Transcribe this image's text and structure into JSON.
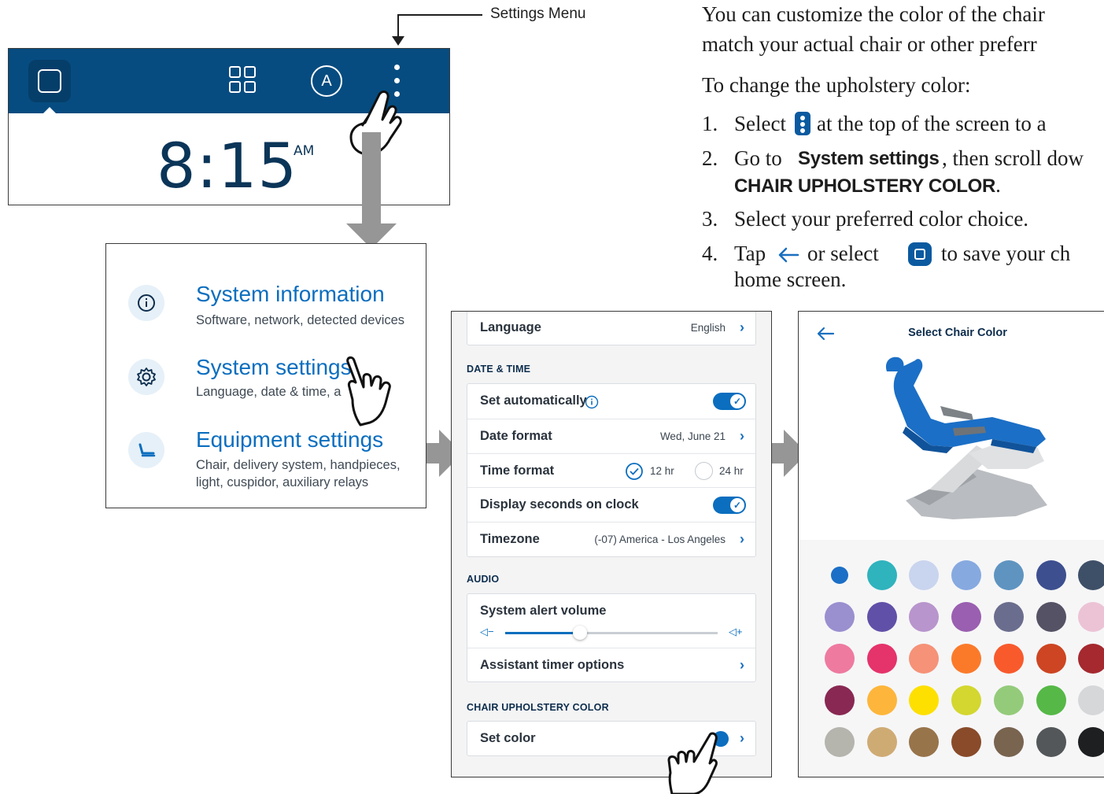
{
  "callout": {
    "settings_menu": "Settings Menu"
  },
  "home_screen": {
    "avatar_letter": "A",
    "time": "8:15",
    "ampm": "AM"
  },
  "settings_menu_list": {
    "items": [
      {
        "title": "System information",
        "subtitle": "Software, network, detected devices",
        "icon": "info-icon"
      },
      {
        "title": "System settings",
        "subtitle": "Language, date & time, a",
        "icon": "gear-icon"
      },
      {
        "title": "Equipment settings",
        "subtitle_line1": "Chair, delivery system, handpieces,",
        "subtitle_line2": "light, cuspidor, auxiliary relays",
        "icon": "chair-icon"
      }
    ]
  },
  "instructions": {
    "intro_line1": "You can customize the color of the chair",
    "intro_line2": "match your actual chair or other preferr",
    "lead": "To change the upholstery color:",
    "step1_num": "1.",
    "step1_a": "Select",
    "step1_b": "at the top of the screen to a",
    "step2_num": "2.",
    "step2_a": "Go to",
    "step2_bold": "System settings",
    "step2_b": ", then scroll dow",
    "step2_bold2": "CHAIR UPHOLSTERY COLOR",
    "step2_end": ".",
    "step3_num": "3.",
    "step3": "Select your preferred color choice.",
    "step4_num": "4.",
    "step4_a": "Tap",
    "step4_b": "or select",
    "step4_c": "to save your ch",
    "step4_line2": "home screen."
  },
  "system_settings": {
    "language_label": "Language",
    "language_value": "English",
    "date_time_header": "DATE & TIME",
    "set_auto_label": "Set automatically",
    "set_auto_on": true,
    "date_format_label": "Date format",
    "date_format_value": "Wed, June 21",
    "time_format_label": "Time format",
    "time_12": "12 hr",
    "time_24": "24 hr",
    "time_selected": "12 hr",
    "display_seconds_label": "Display seconds on clock",
    "display_seconds_on": true,
    "timezone_label": "Timezone",
    "timezone_value": "(-07) America - Los Angeles",
    "audio_header": "AUDIO",
    "alert_volume_label": "System alert volume",
    "alert_volume_level": 0.35,
    "vol_down": "◁−",
    "vol_up": "◁+",
    "timer_options_label": "Assistant timer options",
    "upholstery_header": "CHAIR UPHOLSTERY COLOR",
    "set_color_label": "Set color"
  },
  "chair_color": {
    "title": "Select Chair Color",
    "selected_color": "#1b6fc6",
    "swatches": [
      "#1b6fc6",
      "#2fb3bd",
      "#c9d4ee",
      "#86a9e0",
      "#5f94c0",
      "#3d4f8f",
      "#3e5068",
      "#9a8fcf",
      "#6150a8",
      "#b895cc",
      "#9a5fb0",
      "#6b6d8e",
      "#555265",
      "#ecc3d5",
      "#ee7aa0",
      "#e5336b",
      "#f59278",
      "#fb7a2a",
      "#f85a2c",
      "#cd4522",
      "#a5292f",
      "#892852",
      "#fdb63b",
      "#fde000",
      "#d3d72f",
      "#94cb7b",
      "#56b847",
      "#d5d7d8",
      "#b5b4ad",
      "#cfab74",
      "#98744a",
      "#894b2a",
      "#796450",
      "#535759",
      "#1e1f21"
    ]
  },
  "colors": {
    "brand_blue": "#064c80",
    "accent": "#0b6ebf"
  }
}
